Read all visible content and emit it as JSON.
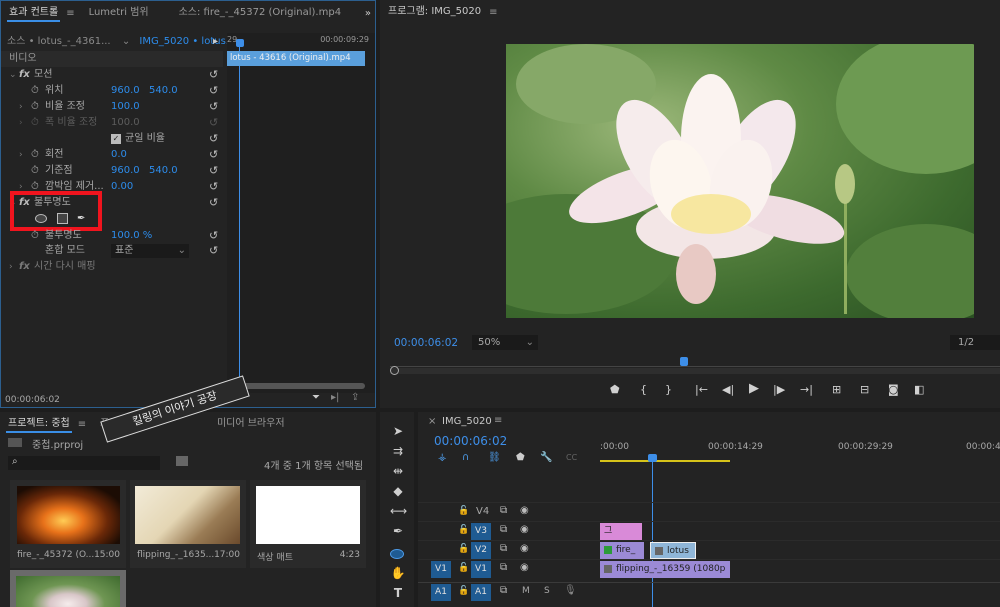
{
  "effects": {
    "tabs": [
      "효과 컨트롤",
      "Lumetri 범위",
      "소스: fire_-_45372 (Original).mp4"
    ],
    "source_label": "소스 • lotus_-_4361...",
    "seq_label": "IMG_5020 • lotus...",
    "ruler_start": "29",
    "ruler_end": "00:00:09:29",
    "clip_name": "lotus - 43616 (Original).mp4",
    "section_video": "비디오",
    "motion": "모션",
    "position": {
      "label": "위치",
      "x": "960.0",
      "y": "540.0"
    },
    "scale": {
      "label": "비율 조정",
      "value": "100.0"
    },
    "scale_width": {
      "label": "폭 비율 조정",
      "value": "100.0"
    },
    "uniform": "균일 비율",
    "rotation": {
      "label": "회전",
      "value": "0.0"
    },
    "anchor": {
      "label": "기준점",
      "x": "960.0",
      "y": "540.0"
    },
    "antiflicker": {
      "label": "깜박임 제거...",
      "value": "0.00"
    },
    "opacity": "불투명도",
    "opacity_value": {
      "label": "불투명도",
      "value": "100.0 %"
    },
    "blend": {
      "label": "혼합 모드",
      "value": "표준"
    },
    "time_remap": "시간 다시 매핑",
    "timecode": "00:00:06:02"
  },
  "program": {
    "title": "프로그램: IMG_5020",
    "timecode": "00:00:06:02",
    "zoom": "50%",
    "quality": "1/2"
  },
  "project": {
    "tabs": [
      "프로젝트: 중첩",
      "프로그램",
      "미디어 브라우저"
    ],
    "file": "중첩.prproj",
    "count": "4개 중 1개 항목 선택됨",
    "items": [
      {
        "name": "fire_-_45372 (O...",
        "dur": "15:00"
      },
      {
        "name": "flipping_-_1635...",
        "dur": "17:00"
      },
      {
        "name": "색상 매트",
        "dur": "4:23"
      }
    ]
  },
  "watermark": "킬링의 이야기 공장",
  "timeline": {
    "title": "IMG_5020",
    "timecode": "00:00:06:02",
    "ticks": [
      ":00:00",
      "00:00:14:29",
      "00:00:29:29",
      "00:00:4"
    ],
    "tracks": [
      {
        "name": "V4"
      },
      {
        "name": "V3"
      },
      {
        "name": "V2"
      },
      {
        "name": "V1",
        "src": "V1"
      },
      {
        "name": "A1",
        "src": "A1"
      }
    ],
    "clips": {
      "v3": "그",
      "v2a": "fire_",
      "v2b": "lotus",
      "v1": "flipping_-_16359 (1080p"
    },
    "audio_m": "M",
    "audio_s": "S"
  }
}
